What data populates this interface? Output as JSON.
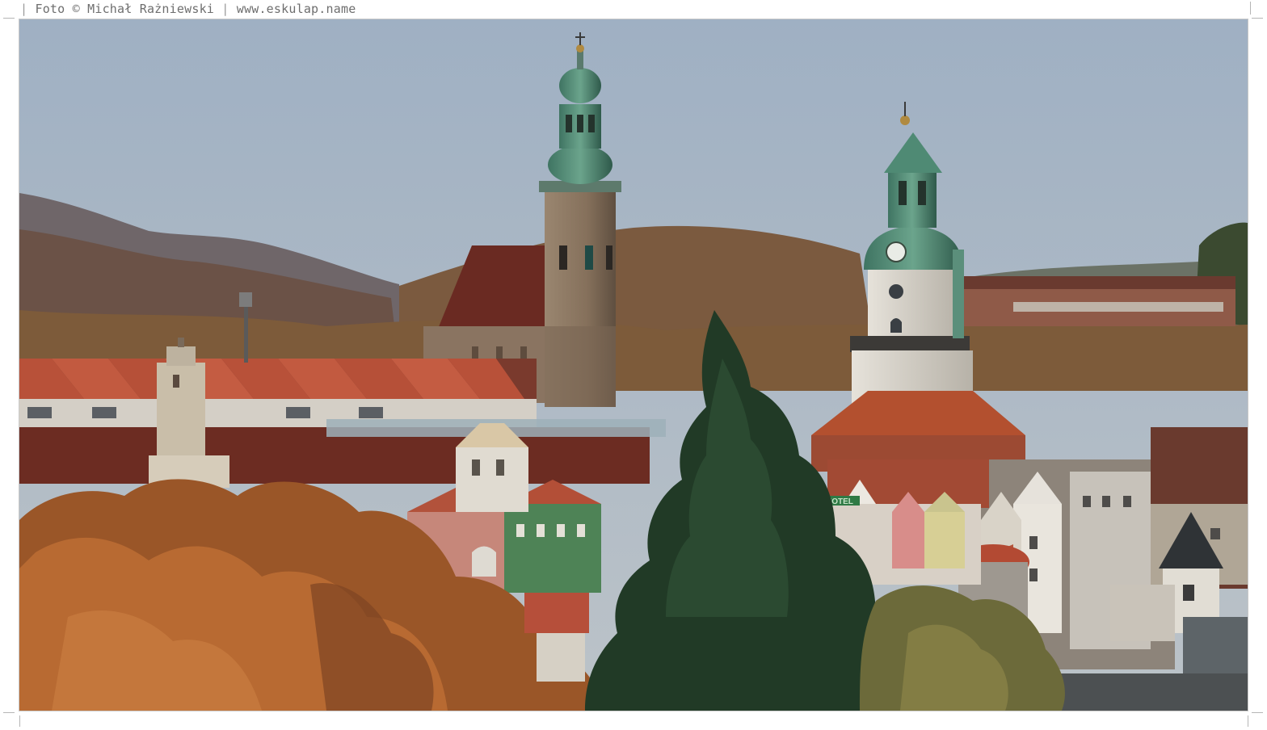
{
  "caption": {
    "prefix": "Foto",
    "copyright_symbol": "©",
    "author": "Michał Rażniewski",
    "separator": "|",
    "website": "www.eskulap.name"
  },
  "photo": {
    "sign_text": "HOTEL",
    "colors": {
      "sky": "#a7b6c7",
      "sky_low": "#b7c0c8",
      "hill_far": "#6e6a6b",
      "hill_near": "#7a5a46",
      "roof_red": "#b74a33",
      "roof_dark": "#6d2a21",
      "copper_green": "#4f8a74",
      "stone_tower": "#8a7560",
      "autumn_tree": "#b0632a",
      "spruce": "#203826"
    }
  }
}
